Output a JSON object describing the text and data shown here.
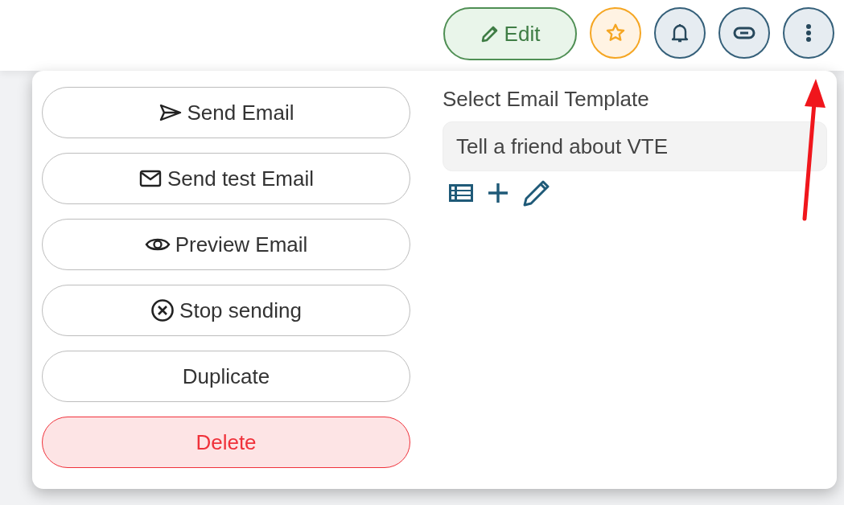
{
  "toolbar": {
    "edit_button": {
      "label": "Edit"
    }
  },
  "menu": {
    "actions": [
      {
        "label": "Send Email",
        "kind": "send"
      },
      {
        "label": "Send test Email",
        "kind": "mail"
      },
      {
        "label": "Preview Email",
        "kind": "preview"
      },
      {
        "label": "Stop sending",
        "kind": "stop"
      },
      {
        "label": "Duplicate",
        "kind": "plain"
      },
      {
        "label": "Delete",
        "kind": "danger"
      }
    ],
    "template": {
      "label": "Select Email Template",
      "value": "Tell a friend about VTE"
    }
  }
}
